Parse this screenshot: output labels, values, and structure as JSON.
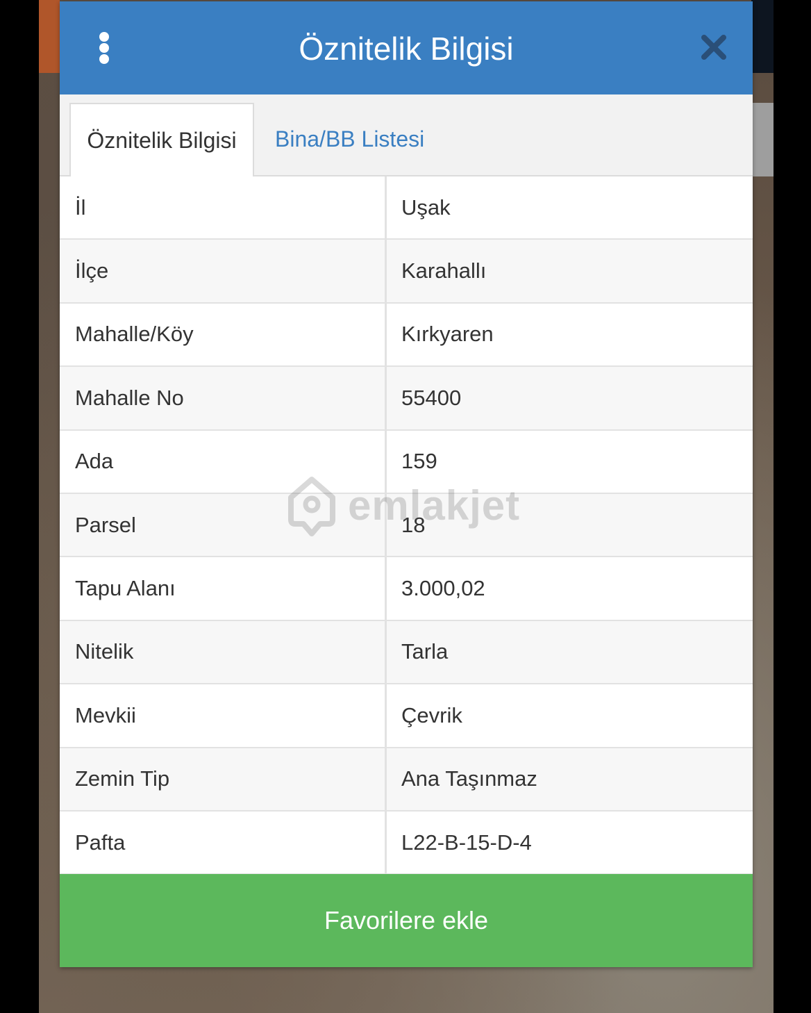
{
  "header": {
    "title": "Öznitelik Bilgisi",
    "color": "#3a7fc2"
  },
  "tabs": [
    {
      "label": "Öznitelik Bilgisi",
      "active": true
    },
    {
      "label": "Bina/BB Listesi",
      "active": false
    }
  ],
  "rows": [
    {
      "key": "İl",
      "value": "Uşak"
    },
    {
      "key": "İlçe",
      "value": "Karahallı"
    },
    {
      "key": "Mahalle/Köy",
      "value": "Kırkyaren"
    },
    {
      "key": "Mahalle No",
      "value": "55400"
    },
    {
      "key": "Ada",
      "value": "159"
    },
    {
      "key": "Parsel",
      "value": "18"
    },
    {
      "key": "Tapu Alanı",
      "value": "3.000,02"
    },
    {
      "key": "Nitelik",
      "value": "Tarla"
    },
    {
      "key": "Mevkii",
      "value": "Çevrik"
    },
    {
      "key": "Zemin Tip",
      "value": "Ana Taşınmaz"
    },
    {
      "key": "Pafta",
      "value": "L22-B-15-D-4"
    }
  ],
  "watermark": {
    "text": "emlakjet",
    "icon": "house-pin-logo"
  },
  "footer": {
    "button_label": "Favorilere ekle",
    "color": "#5cb85c"
  },
  "icons": {
    "menu": "more-vertical-icon",
    "close": "close-icon"
  }
}
